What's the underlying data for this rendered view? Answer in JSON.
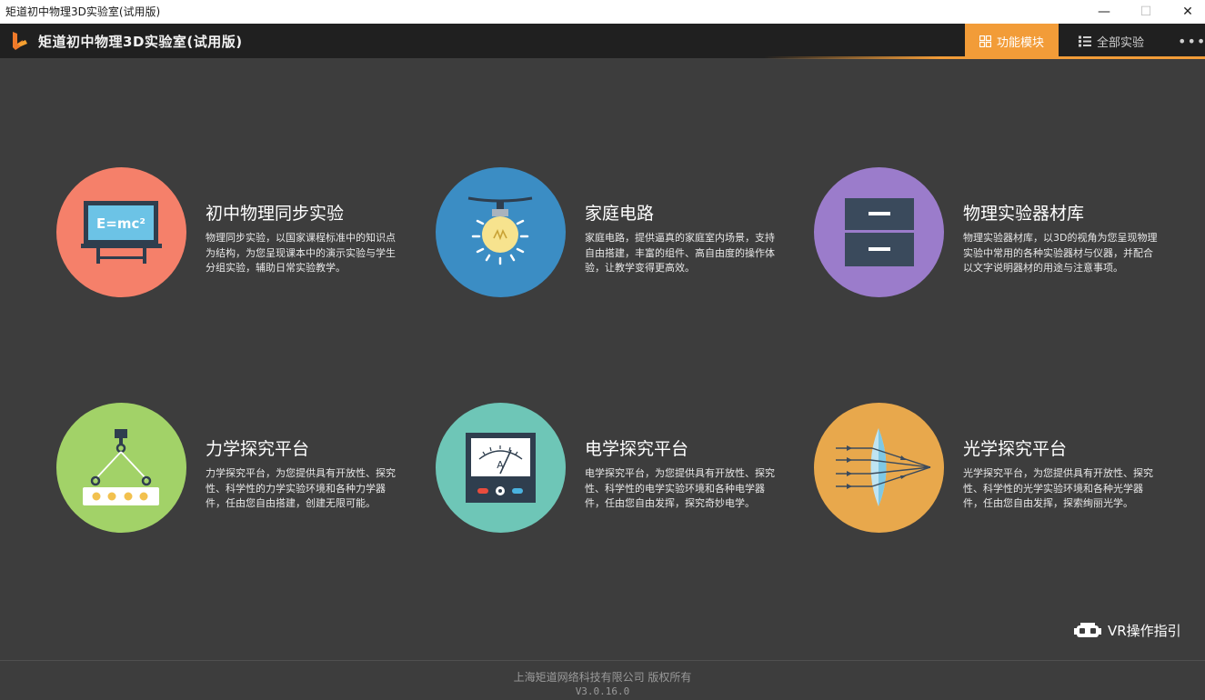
{
  "window": {
    "title": "矩道初中物理3D实验室(试用版)",
    "min_symbol": "—",
    "max_symbol": "☐",
    "close_symbol": "✕"
  },
  "header": {
    "app_title": "矩道初中物理3D实验室(试用版)",
    "logo_icon": "brand-logo",
    "tabs": [
      {
        "label": "功能模块",
        "icon": "grid-icon",
        "active": true
      },
      {
        "label": "全部实验",
        "icon": "list-icon",
        "active": false
      }
    ],
    "more_label": "•••"
  },
  "colors": {
    "accent": "#f29c38",
    "background": "#3d3d3d",
    "header": "#202020",
    "module1": "#f5806a",
    "module2": "#3b8dc4",
    "module3": "#9b7ccb",
    "module4": "#a2d268",
    "module5": "#6ec6b7",
    "module6": "#e8a84c"
  },
  "modules": [
    {
      "title": "初中物理同步实验",
      "desc": "物理同步实验，以国家课程标准中的知识点为结构，为您呈现课本中的演示实验与学生分组实验，辅助日常实验教学。",
      "icon": "blackboard-icon",
      "board_text": "E=mc²"
    },
    {
      "title": "家庭电路",
      "desc": "家庭电路，提供逼真的家庭室内场景，支持自由搭建，丰富的组件、高自由度的操作体验，让教学变得更高效。",
      "icon": "light-bulb-icon"
    },
    {
      "title": "物理实验器材库",
      "desc": "物理实验器材库，以3D的视角为您呈现物理实验中常用的各种实验器材与仪器，并配合以文字说明器材的用途与注意事项。",
      "icon": "cabinet-icon"
    },
    {
      "title": "力学探究平台",
      "desc": "力学探究平台，为您提供具有开放性、探究性、科学性的力学实验环境和各种力学器件，任由您自由搭建，创建无限可能。",
      "icon": "pulley-icon"
    },
    {
      "title": "电学探究平台",
      "desc": "电学探究平台，为您提供具有开放性、探究性、科学性的电学实验环境和各种电学器件，任由您自由发挥，探究奇妙电学。",
      "icon": "ammeter-icon",
      "meter_text": "A"
    },
    {
      "title": "光学探究平台",
      "desc": "光学探究平台，为您提供具有开放性、探究性、科学性的光学实验环境和各种光学器件，任由您自由发挥，探索绚丽光学。",
      "icon": "lens-icon"
    }
  ],
  "vr_guide": {
    "label": "VR操作指引",
    "icon": "vr-headset-icon"
  },
  "footer": {
    "copyright": "上海矩道网络科技有限公司 版权所有",
    "version": "V3.0.16.0"
  }
}
